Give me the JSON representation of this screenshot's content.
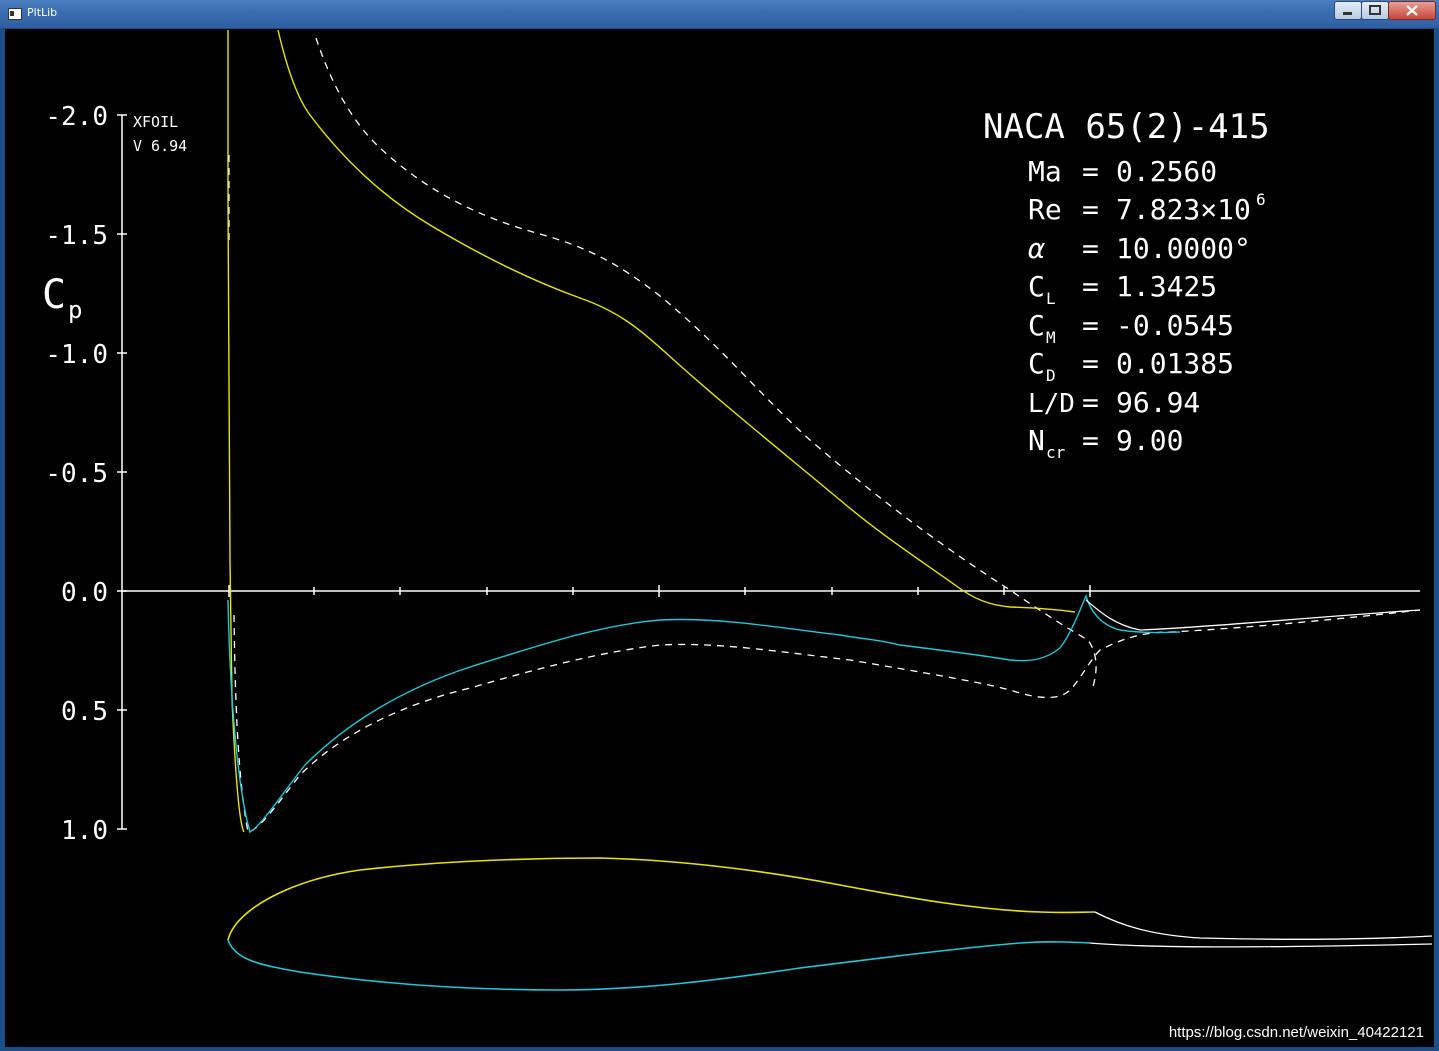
{
  "window": {
    "title": "PltLib"
  },
  "plot": {
    "program": "XFOIL",
    "version": "V 6.94",
    "ylabel_main": "C",
    "ylabel_sub": "p",
    "y_ticks": [
      "-2.0",
      "-1.5",
      "-1.0",
      "-0.5",
      "0.0",
      "0.5",
      "1.0"
    ]
  },
  "info": {
    "airfoil": "NACA 65(2)-415",
    "rows": [
      {
        "sym": "Ma",
        "sub": "",
        "value": "0.2560",
        "sup": ""
      },
      {
        "sym": "Re",
        "sub": "",
        "value": "7.823×10",
        "sup": "6"
      },
      {
        "sym": "α",
        "sub": "",
        "value": "10.0000°",
        "sup": ""
      },
      {
        "sym": "C",
        "sub": "L",
        "value": "1.3425",
        "sup": ""
      },
      {
        "sym": "C",
        "sub": "M",
        "value": "-0.0545",
        "sup": ""
      },
      {
        "sym": "C",
        "sub": "D",
        "value": "0.01385",
        "sup": ""
      },
      {
        "sym": "L/D",
        "sub": "",
        "value": "96.94",
        "sup": ""
      },
      {
        "sym": "N",
        "sub": "cr",
        "value": "9.00",
        "sup": ""
      }
    ],
    "equals": "="
  },
  "colors": {
    "upper": "#e6e600",
    "lower": "#20c8d8",
    "inviscid": "#ffffff",
    "background": "#000000"
  },
  "watermark": "https://blog.csdn.net/weixin_40422121"
}
